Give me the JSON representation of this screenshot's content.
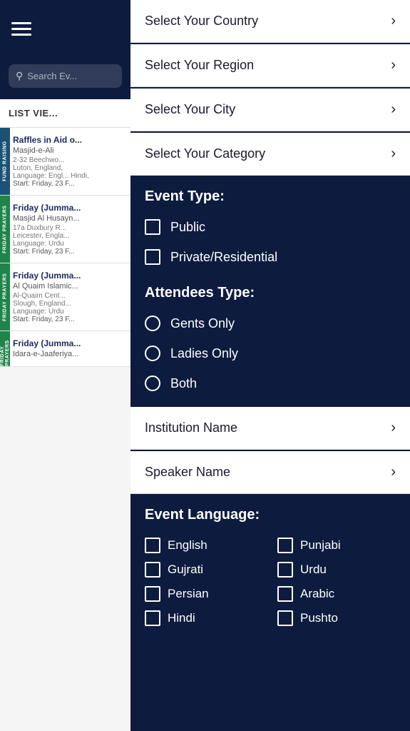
{
  "sidebar": {
    "search_placeholder": "Search Ev...",
    "list_view_label": "LIST VIE...",
    "events": [
      {
        "title": "Raffles in Aid o...",
        "org": "Masjid-e-Ali",
        "address": "2-32 Beechwo...",
        "city": "Luton, England,",
        "language": "Language: Engl... Hindi,",
        "start": "Start: Friday, 23 F...",
        "category": "FUND RAISING",
        "color": "#1a5276"
      },
      {
        "title": "Friday (Jumma...",
        "org": "Masjid Al Husayn...",
        "address": "17a Duxbury R...",
        "city": "Leicester, Engla...",
        "language": "Language: Urdu",
        "start": "Start: Friday, 23 F...",
        "category": "FRIDAY PRAYERS",
        "color": "#1e8449"
      },
      {
        "title": "Friday (Jumma...",
        "org": "Al Quaim Islamic...",
        "address": "Al-Quaim Cent...",
        "city": "Slough, England...",
        "language": "Language: Urdu",
        "start": "Start: Friday, 23 F...",
        "category": "FRIDAY PRAYERS",
        "color": "#1e8449"
      },
      {
        "title": "Friday (Jumma...",
        "org": "Idara-e-Jaaferiya...",
        "address": "",
        "city": "",
        "language": "",
        "start": "",
        "category": "FRIDAY PRAYERS",
        "color": "#1e8449"
      }
    ]
  },
  "filter": {
    "country_label": "Select Your Country",
    "region_label": "Select Your Region",
    "city_label": "Select Your City",
    "category_label": "Select Your Category",
    "event_type_header": "Event Type:",
    "event_type_options": [
      {
        "label": "Public"
      },
      {
        "label": "Private/Residential"
      }
    ],
    "attendees_type_header": "Attendees Type:",
    "attendees_options": [
      {
        "label": "Gents Only"
      },
      {
        "label": "Ladies Only"
      },
      {
        "label": "Both"
      }
    ],
    "institution_label": "Institution Name",
    "speaker_label": "Speaker Name",
    "event_language_header": "Event Language:",
    "languages": [
      {
        "label": "English"
      },
      {
        "label": "Punjabi"
      },
      {
        "label": "Gujrati"
      },
      {
        "label": "Urdu"
      },
      {
        "label": "Persian"
      },
      {
        "label": "Arabic"
      },
      {
        "label": "Hindi"
      },
      {
        "label": "Pushto"
      }
    ]
  }
}
